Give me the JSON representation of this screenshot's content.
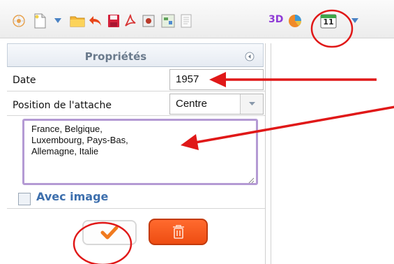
{
  "toolbar": {
    "icons": [
      "target-icon",
      "new-document-icon",
      "chevron-down-icon",
      "folder-icon",
      "undo-icon",
      "save-icon",
      "pdf-icon",
      "image-icon",
      "table-icon",
      "document-icon",
      "3d-label",
      "pie-chart-icon",
      "calendar-icon",
      "chevron-down-icon"
    ],
    "label_3d": "3D",
    "calendar_day": "11"
  },
  "panel": {
    "title": "Propriétés",
    "date_label": "Date",
    "date_value": "1957",
    "attach_label": "Position de l'attache",
    "attach_value": "Centre",
    "text_value": "France, Belgique,\nLuxembourg, Pays-Bas,\nAllemagne, Italie",
    "checkbox_label": "Avec image"
  },
  "colors": {
    "annotation_red": "#e01818",
    "textarea_border": "#b49ad4",
    "delete_button": "#f25414",
    "confirm_check": "#f07a1f",
    "link_blue": "#3d6fad"
  }
}
